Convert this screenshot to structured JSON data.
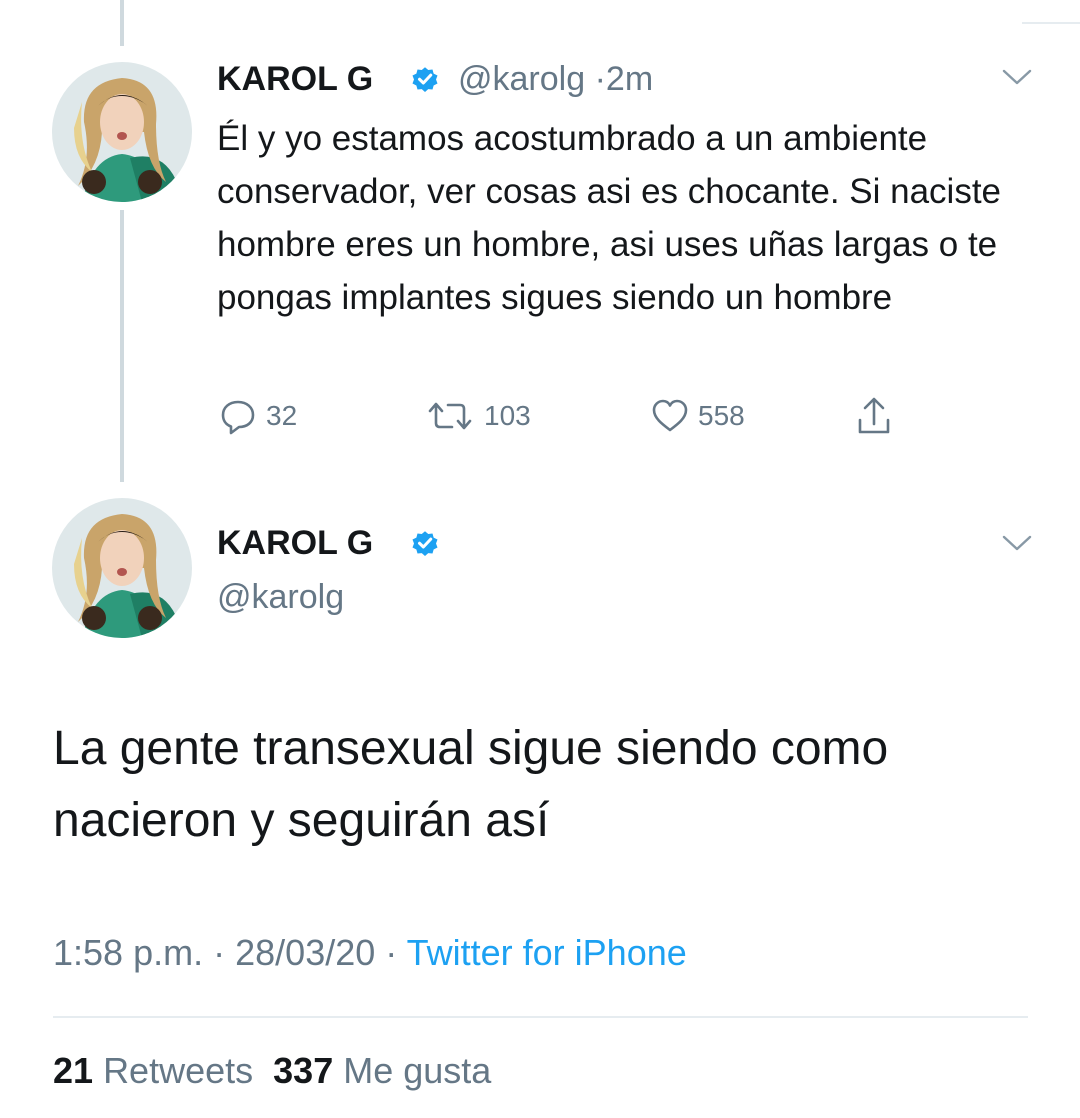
{
  "colors": {
    "text": "#14171a",
    "secondary": "#657786",
    "link": "#1da1f2",
    "verified": "#1da1f2",
    "thread_line": "#cfd9de"
  },
  "reply_tweet": {
    "author_name": "KAROL G",
    "handle": "@karolg",
    "separator": "·",
    "time": "2m",
    "text": "Él y yo estamos acostumbrado a un ambiente conservador, ver cosas asi es chocante. Si naciste hombre eres un hombre, asi uses uñas largas o te pongas implantes sigues siendo un hombre",
    "replies": "32",
    "retweets": "103",
    "likes": "558",
    "icons": [
      "reply-icon",
      "retweet-icon",
      "like-icon",
      "share-icon",
      "chevron-down-icon",
      "verified-icon"
    ]
  },
  "main_tweet": {
    "author_name": "KAROL G",
    "handle": "@karolg",
    "text": "La gente transexual sigue siendo como nacieron y seguirán así",
    "time": "1:58 p.m.",
    "date": "28/03/20",
    "separator": "·",
    "source": "Twitter for iPhone",
    "retweet_count": "21",
    "retweet_label": "Retweets",
    "like_count": "337",
    "like_label": "Me gusta"
  }
}
